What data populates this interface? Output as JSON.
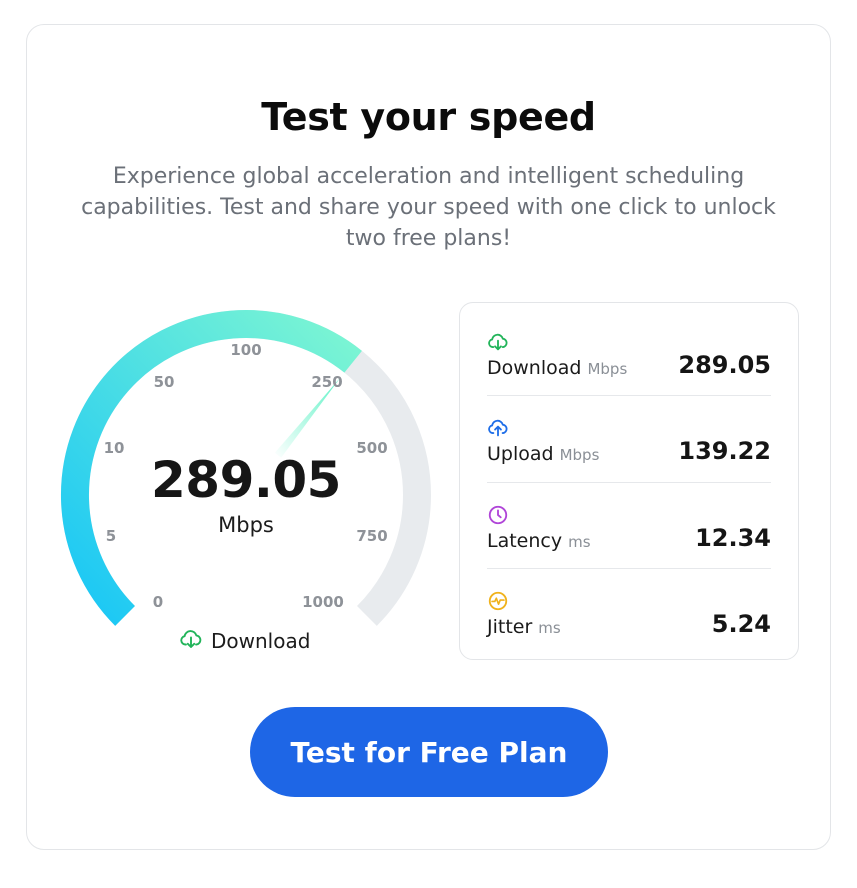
{
  "header": {
    "title": "Test your speed",
    "subtitle": "Experience global acceleration and intelligent scheduling capabilities. Test and share your speed with one click to unlock two free plans!"
  },
  "gauge": {
    "value": "289.05",
    "unit": "Mbps",
    "caption": "Download",
    "caption_icon": "cloud-download-icon",
    "ticks": [
      "0",
      "5",
      "10",
      "50",
      "100",
      "250",
      "500",
      "750",
      "1000"
    ],
    "filled_ticks": 5.15,
    "colors": {
      "start": "#1ac8f5",
      "end": "#78f5d5",
      "track": "#e8ebee",
      "needle": "#5ef2c6"
    }
  },
  "stats": [
    {
      "label": "Download",
      "unit": "Mbps",
      "value": "289.05",
      "icon": "cloud-download-icon",
      "color": "#22b45a"
    },
    {
      "label": "Upload",
      "unit": "Mbps",
      "value": "139.22",
      "icon": "cloud-upload-icon",
      "color": "#1f6ee8"
    },
    {
      "label": "Latency",
      "unit": "ms",
      "value": "12.34",
      "icon": "clock-icon",
      "color": "#b045d8"
    },
    {
      "label": "Jitter",
      "unit": "ms",
      "value": "5.24",
      "icon": "pulse-icon",
      "color": "#f0b21c"
    }
  ],
  "cta": {
    "label": "Test for Free Plan",
    "color": "#1e66e6"
  }
}
